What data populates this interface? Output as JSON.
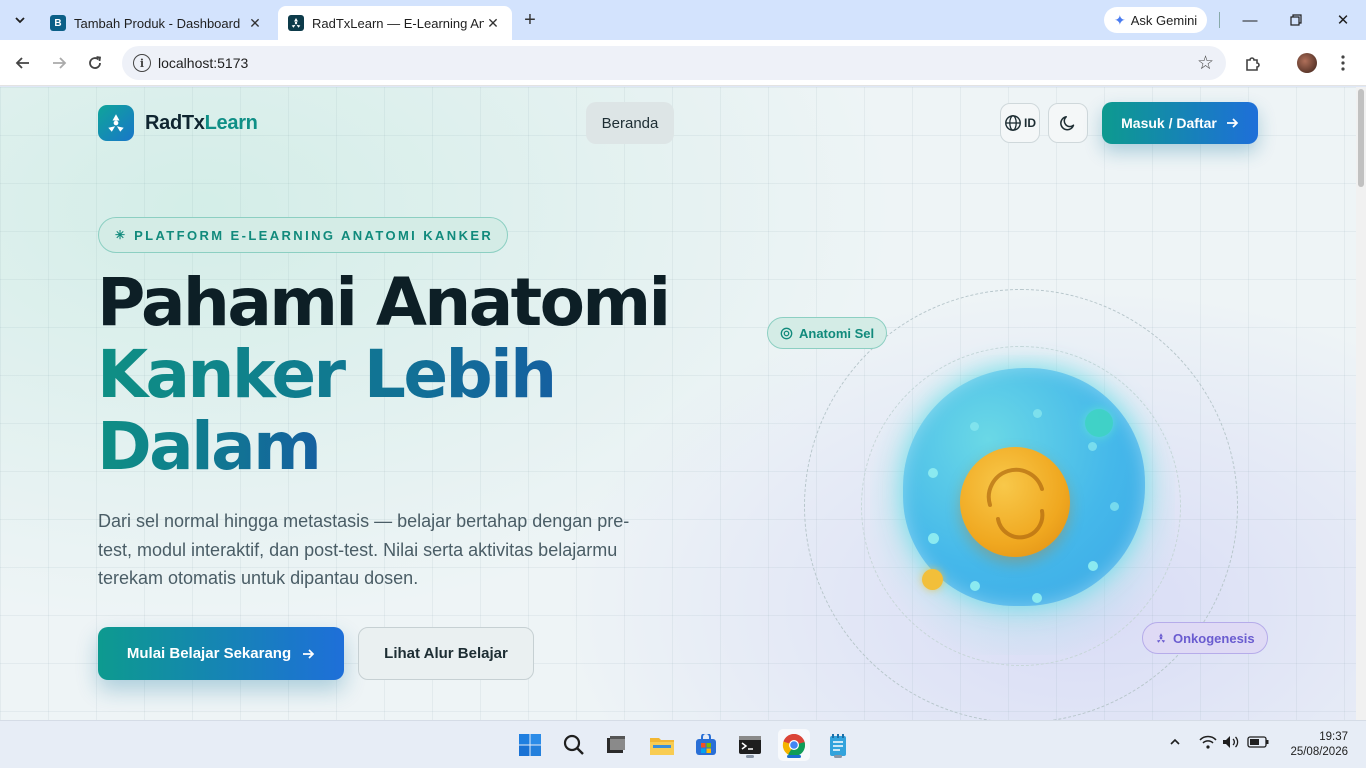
{
  "browser": {
    "tabs": [
      {
        "title": "Tambah Produk - Dashboard",
        "favicon": "B",
        "active": false
      },
      {
        "title": "RadTxLearn — E-Learning Anatomi",
        "active": true
      }
    ],
    "ask_gemini": "Ask Gemini",
    "url": "localhost:5173"
  },
  "site": {
    "brand_part1": "RadTx",
    "brand_part2": "Learn",
    "nav": {
      "home": "Beranda"
    },
    "lang": "ID",
    "auth_button": "Masuk / Daftar"
  },
  "hero": {
    "badge": "PLATFORM E-LEARNING ANATOMI KANKER",
    "title_line1": "Pahami Anatomi",
    "title_line2": "Kanker Lebih",
    "title_line3": "Dalam",
    "description": "Dari sel normal hingga metastasis — belajar bertahap dengan pre-test, modul interaktif, dan post-test. Nilai serta aktivitas belajarmu terekam otomatis untuk dipantau dosen.",
    "primary_button": "Mulai Belajar Sekarang",
    "secondary_button": "Lihat Alur Belajar"
  },
  "illustration": {
    "tag_top": "Anatomi Sel",
    "tag_bottom": "Onkogenesis"
  },
  "taskbar": {
    "time": "19:37",
    "date": "25/08/2026",
    "apps": [
      "start-icon",
      "search-icon",
      "terminal-window-icon",
      "file-explorer-icon",
      "store-icon",
      "command-prompt-icon",
      "chrome-icon",
      "notepad-icon"
    ]
  },
  "colors": {
    "brand_teal": "#0f8f86",
    "brand_blue": "#1e6fd9",
    "tag_violet": "#6a5cd0"
  }
}
